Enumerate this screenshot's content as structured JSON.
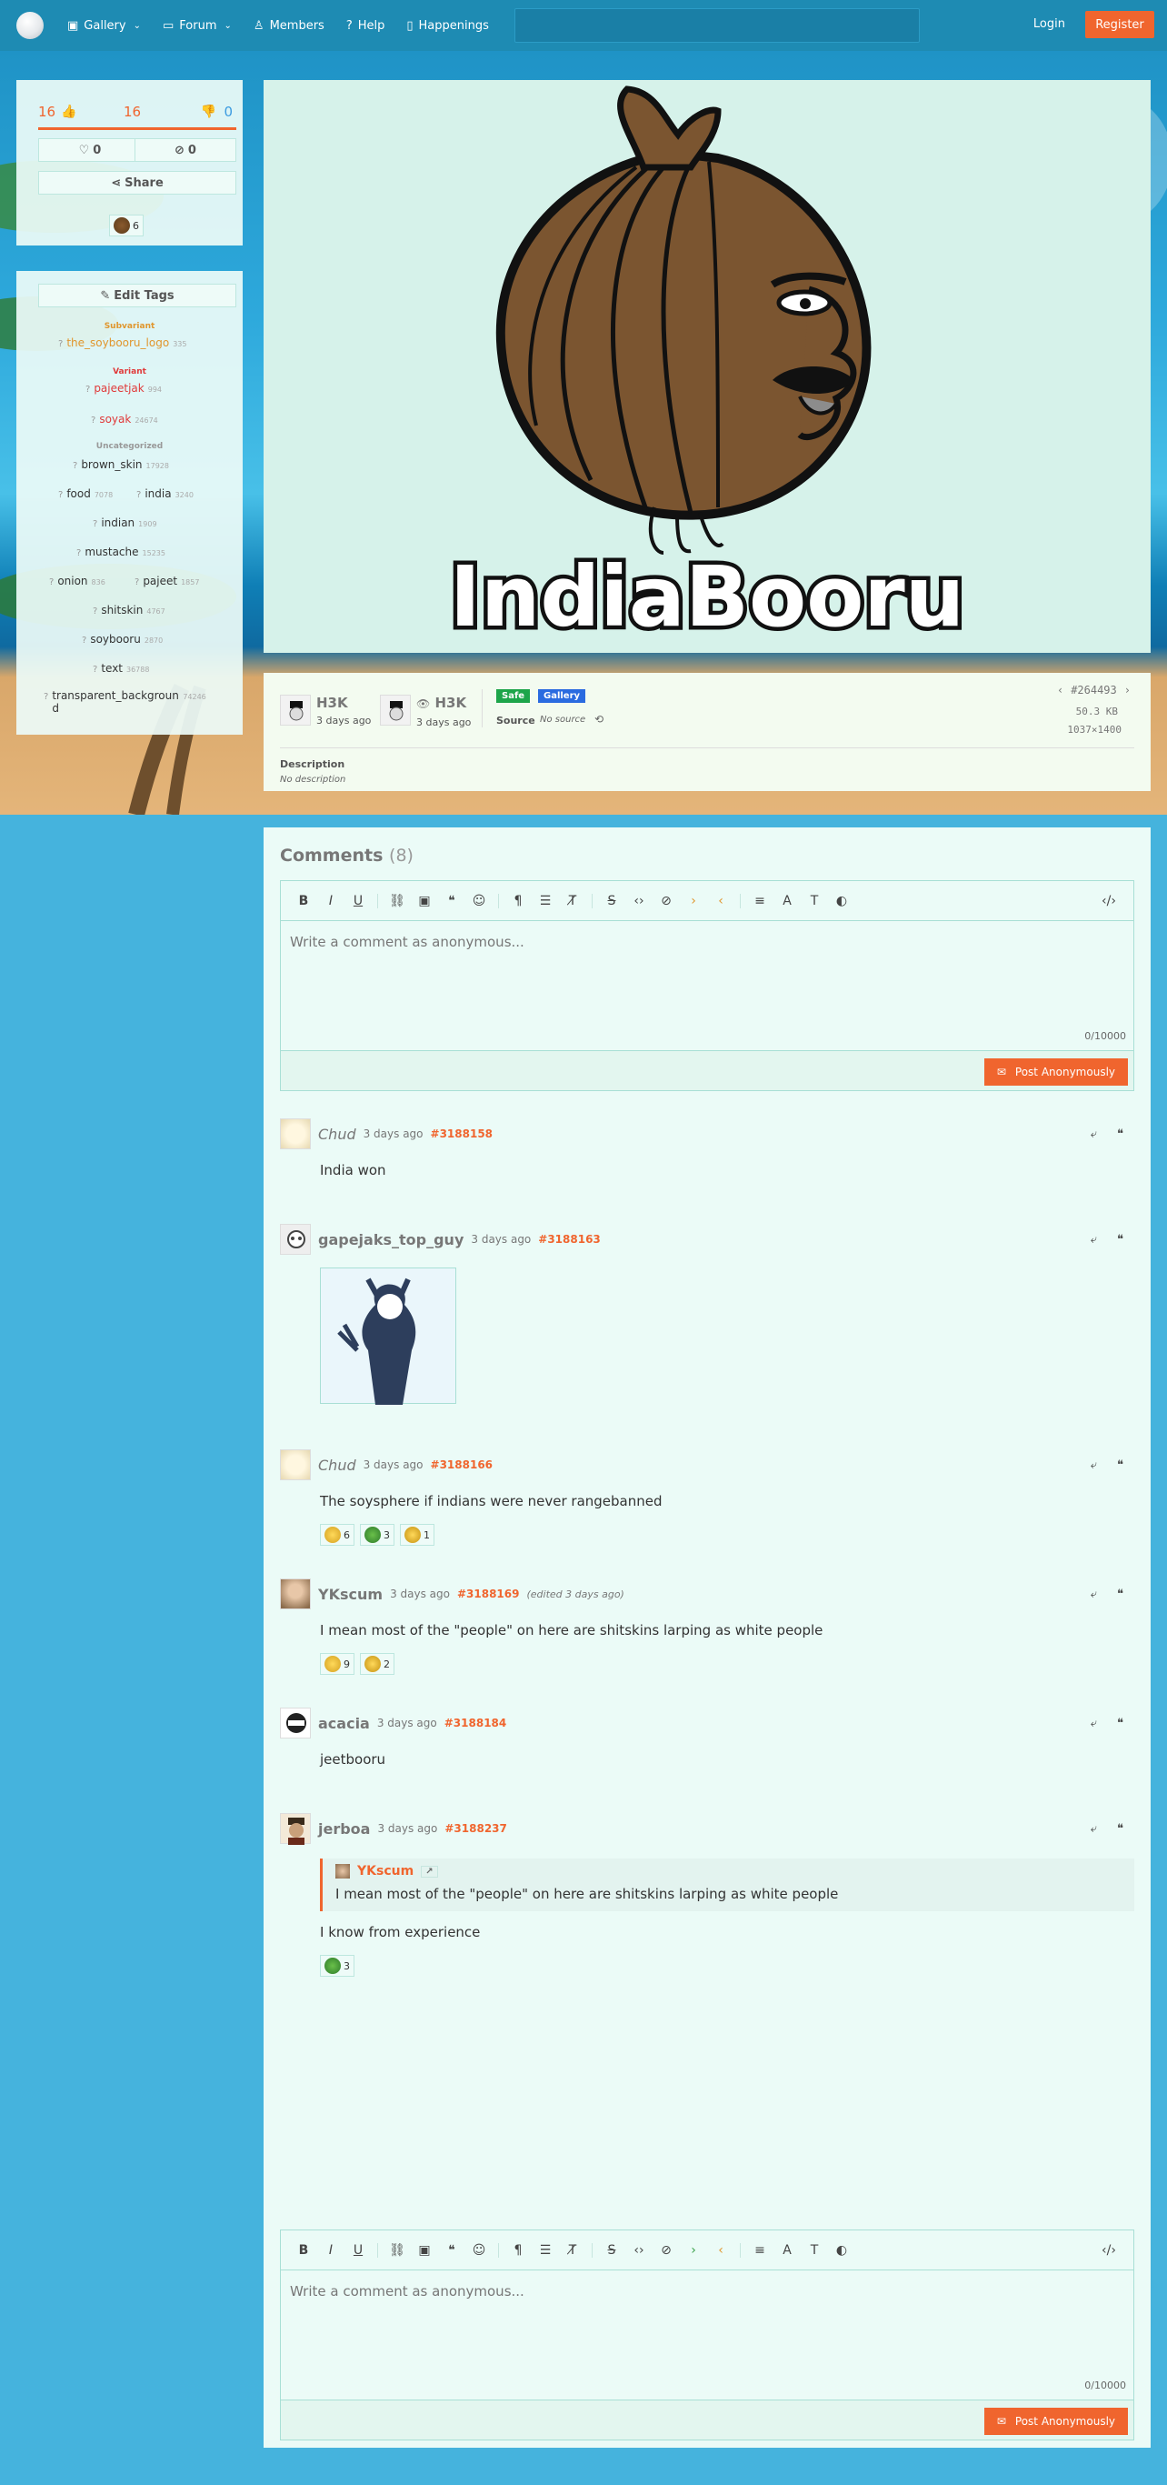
{
  "nav": {
    "items": [
      {
        "label": "Gallery",
        "icon": "image-icon",
        "dropdown": true
      },
      {
        "label": "Forum",
        "icon": "chat-icon",
        "dropdown": true
      },
      {
        "label": "Members",
        "icon": "user-icon",
        "dropdown": false
      },
      {
        "label": "Help",
        "icon": "help-icon",
        "dropdown": false
      },
      {
        "label": "Happenings",
        "icon": "book-icon",
        "dropdown": false
      }
    ],
    "login": "Login",
    "register": "Register"
  },
  "votes": {
    "upvotes": "16",
    "score": "16",
    "downvotes": "0",
    "favorites": "0",
    "hides": "0",
    "share": "Share",
    "reaction_count": "6"
  },
  "tags": {
    "edit_label": "Edit Tags",
    "categories": {
      "subvariant": "Subvariant",
      "variant": "Variant",
      "uncategorized": "Uncategorized"
    },
    "items": [
      {
        "name": "the_soybooru_logo",
        "count": "335"
      },
      {
        "name": "pajeetjak",
        "count": "994"
      },
      {
        "name": "soyak",
        "count": "24674"
      },
      {
        "name": "brown_skin",
        "count": "17928"
      },
      {
        "name": "food",
        "count": "7078"
      },
      {
        "name": "india",
        "count": "3240"
      },
      {
        "name": "indian",
        "count": "1909"
      },
      {
        "name": "mustache",
        "count": "15235"
      },
      {
        "name": "onion",
        "count": "836"
      },
      {
        "name": "pajeet",
        "count": "1857"
      },
      {
        "name": "shitskin",
        "count": "4767"
      },
      {
        "name": "soybooru",
        "count": "2870"
      },
      {
        "name": "text",
        "count": "36788"
      },
      {
        "name": "transparent_background",
        "count": "74246"
      }
    ]
  },
  "image": {
    "caption": "IndiaBooru"
  },
  "info": {
    "uploader": "H3K",
    "uploaded": "3 days ago",
    "viewer": "H3K",
    "viewed": "3 days ago",
    "rating_badge": "Safe",
    "gallery_badge": "Gallery",
    "source_label": "Source",
    "source_value": "No source",
    "post_id": "#264493",
    "file_size": "50.3 KB",
    "dimensions": "1037×1400",
    "description_label": "Description",
    "description_value": "No description"
  },
  "comments": {
    "title": "Comments",
    "count": "(8)",
    "placeholder": "Write a comment as anonymous...",
    "char_count": "0/10000",
    "post_label": "Post Anonymously",
    "list": [
      {
        "author": "Chud",
        "time": "3 days ago",
        "id": "#3188158",
        "body": "India won"
      },
      {
        "author": "gapejaks_top_guy",
        "time": "3 days ago",
        "id": "#3188163"
      },
      {
        "author": "Chud",
        "time": "3 days ago",
        "id": "#3188166",
        "body": "The soysphere if indians were never rangebanned",
        "reactions": [
          "6",
          "3",
          "1"
        ]
      },
      {
        "author": "YKscum",
        "time": "3 days ago",
        "id": "#3188169",
        "edited": "(edited 3 days ago)",
        "body": "I mean most of the \"people\" on here are shitskins larping as white people",
        "reactions": [
          "9",
          "2"
        ]
      },
      {
        "author": "acacia",
        "time": "3 days ago",
        "id": "#3188184",
        "body": "jeetbooru"
      },
      {
        "author": "jerboa",
        "time": "3 days ago",
        "id": "#3188237",
        "quote_author": "YKscum",
        "quote_link": "↗",
        "quote_text": "I mean most of the \"people\" on here are shitskins larping as white people",
        "body": "I know from experience",
        "reactions": [
          "3"
        ]
      }
    ]
  },
  "colors": {
    "accent": "#f0652e",
    "nav": "#1e8bb3",
    "panel": "#ebfbf7"
  }
}
